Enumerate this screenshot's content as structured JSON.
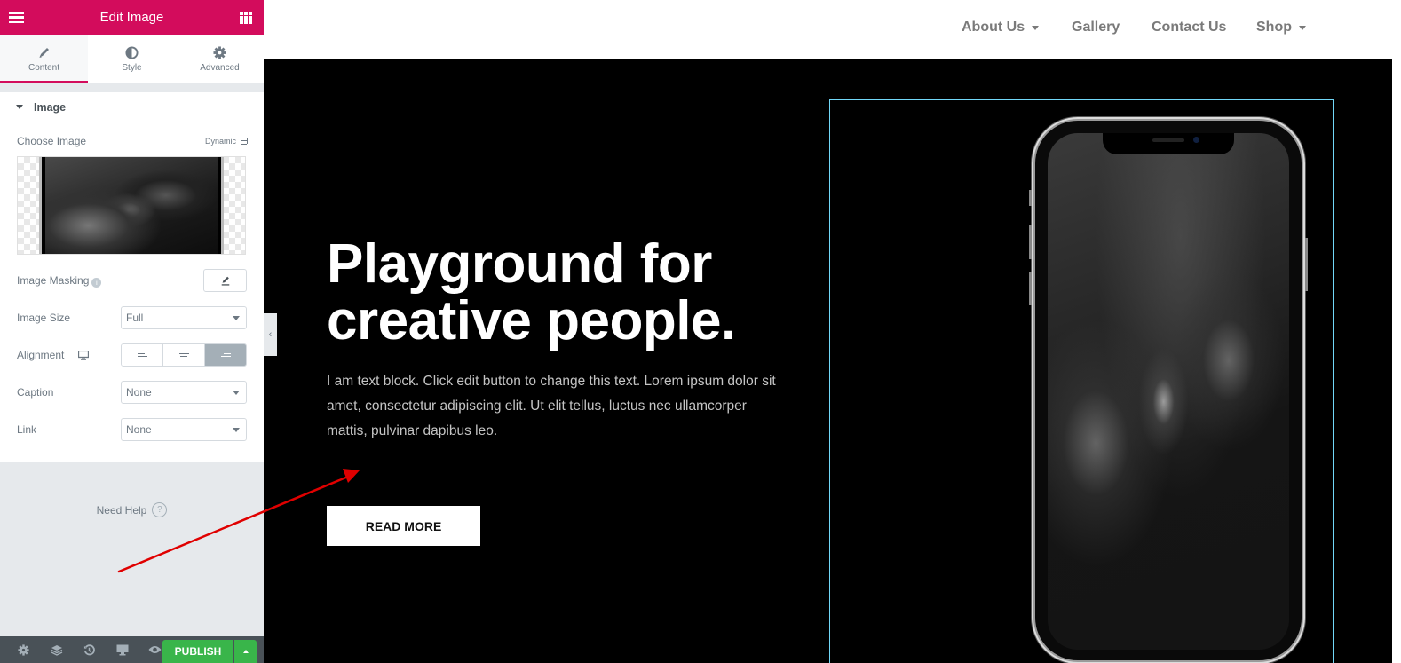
{
  "panel": {
    "title": "Edit Image",
    "tabs": [
      {
        "label": "Content",
        "icon": "pencil-icon",
        "active": true
      },
      {
        "label": "Style",
        "icon": "half-circle-icon",
        "active": false
      },
      {
        "label": "Advanced",
        "icon": "gear-icon",
        "active": false
      }
    ],
    "section_title": "Image",
    "choose_image_label": "Choose Image",
    "dynamic_label": "Dynamic",
    "image_masking_label": "Image Masking",
    "image_size_label": "Image Size",
    "image_size_value": "Full",
    "alignment_label": "Alignment",
    "alignment_selected": "right",
    "caption_label": "Caption",
    "caption_value": "None",
    "link_label": "Link",
    "link_value": "None",
    "need_help": "Need Help",
    "footer": {
      "icons": [
        "settings-icon",
        "navigator-layers-icon",
        "history-icon",
        "responsive-desktop-icon",
        "preview-eye-icon"
      ],
      "publish_label": "PUBLISH"
    }
  },
  "site": {
    "nav": [
      {
        "label": "About Us",
        "dropdown": true
      },
      {
        "label": "Gallery",
        "dropdown": false
      },
      {
        "label": "Contact Us",
        "dropdown": false
      },
      {
        "label": "Shop",
        "dropdown": true
      }
    ],
    "hero": {
      "headline_line1": "Playground for",
      "headline_line2": "creative people.",
      "body": "I am text block. Click edit button to change this text. Lorem ipsum dolor sit amet, consectetur adipiscing elit. Ut elit tellus, luctus nec ullamcorper mattis, pulvinar dapibus leo.",
      "button_label": "READ MORE"
    }
  },
  "colors": {
    "brand": "#d30c5c",
    "publish": "#39b54a",
    "selection_outline": "#71d7f7",
    "annotation_arrow": "#e00000"
  }
}
